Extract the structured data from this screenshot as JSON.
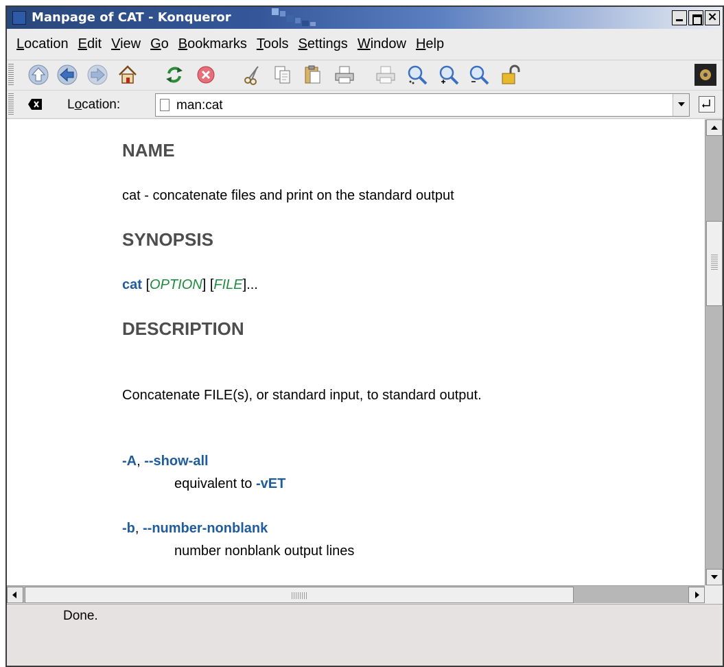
{
  "window": {
    "title": "Manpage of CAT - Konqueror"
  },
  "menubar": {
    "items": [
      {
        "pre": "",
        "key": "L",
        "post": "ocation"
      },
      {
        "pre": "",
        "key": "E",
        "post": "dit"
      },
      {
        "pre": "",
        "key": "V",
        "post": "iew"
      },
      {
        "pre": "",
        "key": "G",
        "post": "o"
      },
      {
        "pre": "",
        "key": "B",
        "post": "ookmarks"
      },
      {
        "pre": "",
        "key": "T",
        "post": "ools"
      },
      {
        "pre": "",
        "key": "S",
        "post": "ettings"
      },
      {
        "pre": "",
        "key": "W",
        "post": "indow"
      },
      {
        "pre": "",
        "key": "H",
        "post": "elp"
      }
    ]
  },
  "toolbar": {
    "icons": [
      "up-icon",
      "back-icon",
      "forward-icon",
      "home-icon",
      "reload-icon",
      "stop-icon",
      "cut-icon",
      "copy-icon",
      "paste-icon",
      "print-icon",
      "print-frame-icon",
      "find-icon",
      "zoom-in-icon",
      "zoom-out-icon",
      "security-lock-icon",
      "throbber-icon"
    ]
  },
  "location": {
    "label_pre": "L",
    "label_key": "o",
    "label_post": "cation:",
    "value": "man:cat"
  },
  "page": {
    "name_heading": "NAME",
    "name_text": "cat - concatenate files and print on the standard output",
    "synopsis_heading": "SYNOPSIS",
    "synopsis_cmd": "cat",
    "synopsis_open1": " [",
    "synopsis_arg1": "OPTION",
    "synopsis_mid": "] [",
    "synopsis_arg2": "FILE",
    "synopsis_close": "]...",
    "description_heading": "DESCRIPTION",
    "description_text": "Concatenate FILE(s), or standard input, to standard output.",
    "options": [
      {
        "flag": "-A",
        "sep": ", ",
        "long": "--show-all",
        "desc_pre": "equivalent to ",
        "desc_opt": "-vET"
      },
      {
        "flag": "-b",
        "sep": ", ",
        "long": "--number-nonblank",
        "desc_pre": "number nonblank output lines",
        "desc_opt": ""
      }
    ]
  },
  "status": {
    "text": "Done."
  },
  "colors": {
    "link_blue": "#1f5c9c",
    "arg_green": "#1e8c3d",
    "heading_gray": "#4d4d4d",
    "titlebar_blue": "#28477b"
  }
}
